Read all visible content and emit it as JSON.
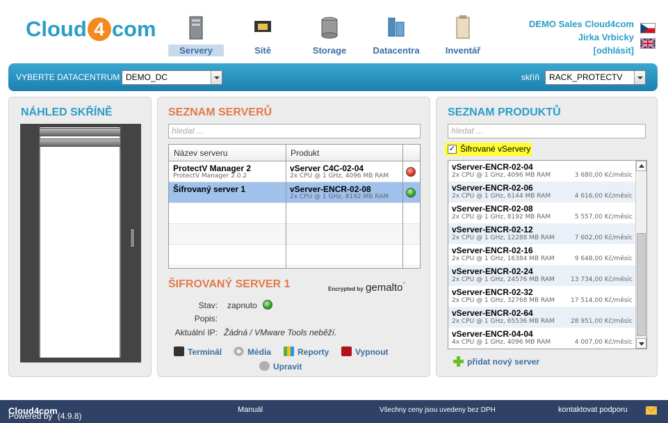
{
  "brand": {
    "logo_left": "Cloud",
    "logo_mid": "4",
    "logo_right": "com"
  },
  "nav": [
    {
      "label": "Servery",
      "icon": "server-icon",
      "active": true
    },
    {
      "label": "Sítě",
      "icon": "network-icon",
      "active": false
    },
    {
      "label": "Storage",
      "icon": "storage-icon",
      "active": false
    },
    {
      "label": "Datacentra",
      "icon": "datacenter-icon",
      "active": false
    },
    {
      "label": "Inventář",
      "icon": "inventory-icon",
      "active": false
    }
  ],
  "user": {
    "company": "DEMO Sales Cloud4com",
    "name": "Jirka Vrbicky",
    "logout": "[odhlásit]"
  },
  "topbar": {
    "dc_label": "VYBERTE DATACENTRUM",
    "dc_value": "DEMO_DC",
    "rack_label": "skříň",
    "rack_value": "RACK_PROTECTV"
  },
  "rack_panel": {
    "title": "NÁHLED SKŘÍNĚ"
  },
  "servers_panel": {
    "title": "SEZNAM SERVERŮ",
    "search_placeholder": "hledat ...",
    "col_name": "Název serveru",
    "col_product": "Produkt",
    "rows": [
      {
        "name": "ProtectV Manager 2",
        "sub": "ProtectV Manager 2.0.2",
        "product": "vServer C4C-02-04",
        "spec": "2x CPU @ 1 GHz, 4096 MB RAM",
        "status": "red"
      },
      {
        "name": "Šifrovaný server 1",
        "sub": "",
        "product": "vServer-ENCR-02-08",
        "spec": "2x CPU @ 1 GHz, 8192 MB RAM",
        "status": "green"
      }
    ],
    "detail": {
      "title": "ŠIFROVANÝ SERVER 1",
      "encrypted_by": "Encrypted by",
      "brand": "gemalto",
      "brand_mark": "°",
      "state_label": "Stav:",
      "state_value": "zapnuto",
      "desc_label": "Popis:",
      "ip_label": "Aktuální IP:",
      "ip_value": "Žádná / VMware Tools neběží."
    },
    "actions": {
      "terminal": "Terminál",
      "media": "Média",
      "reports": "Reporty",
      "shutdown": "Vypnout",
      "edit": "Upravit"
    }
  },
  "products_panel": {
    "title": "SEZNAM PRODUKTŮ",
    "search_placeholder": "hledat ...",
    "filter_label": "Šifrované vServery",
    "filter_checked": true,
    "items": [
      {
        "name": "vServer-ENCR-02-04",
        "spec": "2x CPU @ 1 GHz, 4096 MB RAM",
        "price": "3 680,00 Kč/měsíc"
      },
      {
        "name": "vServer-ENCR-02-06",
        "spec": "2x CPU @ 1 GHz, 6144 MB RAM",
        "price": "4 616,00 Kč/měsíc"
      },
      {
        "name": "vServer-ENCR-02-08",
        "spec": "2x CPU @ 1 GHz, 8192 MB RAM",
        "price": "5 557,00 Kč/měsíc"
      },
      {
        "name": "vServer-ENCR-02-12",
        "spec": "2x CPU @ 1 GHz, 12288 MB RAM",
        "price": "7 602,00 Kč/měsíc"
      },
      {
        "name": "vServer-ENCR-02-16",
        "spec": "2x CPU @ 1 GHz, 16384 MB RAM",
        "price": "9 648,00 Kč/měsíc"
      },
      {
        "name": "vServer-ENCR-02-24",
        "spec": "2x CPU @ 1 GHz, 24576 MB RAM",
        "price": "13 734,00 Kč/měsíc"
      },
      {
        "name": "vServer-ENCR-02-32",
        "spec": "2x CPU @ 1 GHz, 32768 MB RAM",
        "price": "17 514,00 Kč/měsíc"
      },
      {
        "name": "vServer-ENCR-02-64",
        "spec": "2x CPU @ 1 GHz, 65536 MB RAM",
        "price": "28 951,00 Kč/měsíc"
      },
      {
        "name": "vServer-ENCR-04-04",
        "spec": "4x CPU @ 1 GHz, 4096 MB RAM",
        "price": "4 007,00 Kč/měsíc"
      }
    ],
    "add_label": "přidat nový server"
  },
  "footer": {
    "powered": "Powered by",
    "brand": "Cloud4com",
    "version": "(4.9.8)",
    "manual": "Manuál",
    "vat_note": "Všechny ceny jsou uvedeny bez DPH",
    "contact": "kontaktovat podporu"
  },
  "colors": {
    "accent": "#2a9ec6",
    "orange": "#e07a4a",
    "bar": "#1b7fb0",
    "footer": "#2f4266",
    "highlight": "#ffff33",
    "selected_row": "#9fc1ec"
  }
}
